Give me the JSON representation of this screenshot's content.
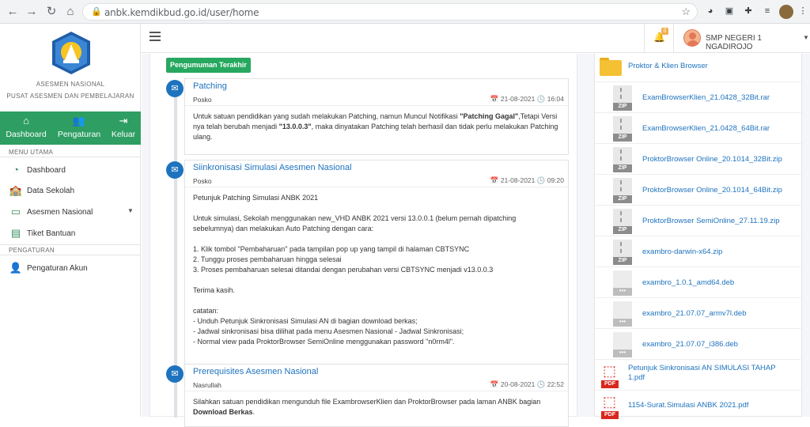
{
  "browser": {
    "url": "anbk.kemdikbud.go.id/user/home"
  },
  "sidebar": {
    "brand_line1": "ASESMEN NASIONAL",
    "brand_line2": "PUSAT ASESMEN DAN PEMBELAJARAN",
    "quick": [
      {
        "label": "Dashboard",
        "icon": "home-icon"
      },
      {
        "label": "Pengaturan",
        "icon": "users-cog-icon"
      },
      {
        "label": "Keluar",
        "icon": "sign-out-icon"
      }
    ],
    "section_main": "MENU UTAMA",
    "menu": [
      {
        "label": "Dashboard",
        "icon": "tachometer-icon"
      },
      {
        "label": "Data Sekolah",
        "icon": "school-icon"
      },
      {
        "label": "Asesmen Nasional",
        "icon": "monitor-icon"
      },
      {
        "label": "Tiket Bantuan",
        "icon": "ticket-icon"
      }
    ],
    "section_settings": "PENGATURAN",
    "settings": [
      {
        "label": "Pengaturan Akun",
        "icon": "user-settings-icon"
      }
    ]
  },
  "topbar": {
    "notif_count": "0",
    "user_name": "SMP NEGERI 1 NGADIROJO"
  },
  "announcements": {
    "badge": "Pengumuman Terakhir",
    "items": [
      {
        "title": "Patching",
        "author": "Posko",
        "date": "21-08-2021",
        "time": "16:04",
        "body_pre": "Untuk satuan pendidikan yang sudah melakukan Patching, namun Muncul Notifikasi ",
        "body_b1": "\"Patching Gagal\"",
        "body_mid": ",Tetapi Versi nya telah berubah menjadi ",
        "body_b2": "\"13.0.0.3\"",
        "body_post": ", maka dinyatakan Patching telah berhasil dan tidak perlu melakukan Patching ulang."
      },
      {
        "title": "Siinkronisasi Simulasi Asesmen Nasional",
        "author": "Posko",
        "date": "21-08-2021",
        "time": "09:20",
        "lines": [
          "Petunjuk Patching Simulasi ANBK 2021",
          "",
          "Untuk simulasi, Sekolah menggunakan new_VHD ANBK 2021 versi 13.0.0.1 (belum pernah dipatching sebelumnya) dan melakukan Auto Patching dengan cara:",
          "",
          "1. Klik tombol \"Pembaharuan\" pada tampilan pop up yang tampil di halaman CBTSYNC",
          "2. Tunggu proses pembaharuan hingga selesai",
          "3. Proses pembaharuan selesai ditandai dengan perubahan versi CBTSYNC menjadi v13.0.0.3",
          "",
          "Terima kasih.",
          "",
          "catatan:",
          "- Unduh Petunjuk Sinkronisasi Simulasi AN di bagian download berkas;",
          "- Jadwal sinkronisasi bisa dilihat pada menu Asesmen Nasional - Jadwal Sinkronisasi;",
          "- Normal view pada ProktorBrowser SemiOnline menggunakan password \"n0rm4l\"."
        ]
      },
      {
        "title": "Prerequisites Asesmen Nasional",
        "author": "Nasrullah",
        "date": "20-08-2021",
        "time": "22:52",
        "body_pre": "Silahkan satuan pendidikan mengunduh file ExambrowserKlien dan ProktorBrowser pada laman ANBK bagian ",
        "body_b1": "Download Berkas",
        "body_post": "."
      }
    ]
  },
  "downloads": {
    "folder": "Proktor & Klien Browser",
    "files": [
      {
        "name": "ExamBrowserKlien_21.0428_32Bit.rar",
        "type": "ZIP"
      },
      {
        "name": "ExamBrowserKlien_21.0428_64Bit.rar",
        "type": "ZIP"
      },
      {
        "name": "ProktorBrowser Online_20.1014_32Bit.zip",
        "type": "ZIP"
      },
      {
        "name": "ProktorBrowser Online_20.1014_64Bit.zip",
        "type": "ZIP"
      },
      {
        "name": "ProktorBrowser SemiOnline_27.11.19.zip",
        "type": "ZIP"
      },
      {
        "name": "exambro-darwin-x64.zip",
        "type": "ZIP"
      },
      {
        "name": "exambro_1.0.1_amd64.deb",
        "type": "deb"
      },
      {
        "name": "exambro_21.07.07_armv7l.deb",
        "type": "deb"
      },
      {
        "name": "exambro_21.07.07_i386.deb",
        "type": "deb"
      }
    ],
    "pdfs": [
      {
        "name": "Petunjuk Sinkronisasi AN SIMULASI TAHAP 1.pdf",
        "type": "PDF"
      },
      {
        "name": "1154-Surat.Simulasi ANBK 2021.pdf",
        "type": "PDF"
      }
    ]
  }
}
